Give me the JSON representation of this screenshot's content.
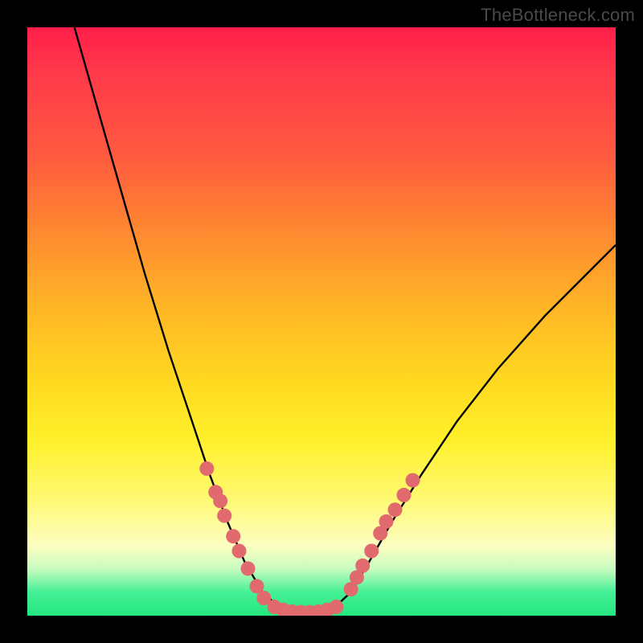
{
  "watermark": "TheBottleneck.com",
  "chart_data": {
    "type": "line",
    "title": "",
    "xlabel": "",
    "ylabel": "",
    "xlim": [
      0,
      100
    ],
    "ylim": [
      0,
      100
    ],
    "curve": {
      "name": "bottleneck-curve",
      "points": [
        {
          "x": 8,
          "y": 100
        },
        {
          "x": 12,
          "y": 86
        },
        {
          "x": 16,
          "y": 72
        },
        {
          "x": 20,
          "y": 58
        },
        {
          "x": 24,
          "y": 45
        },
        {
          "x": 28,
          "y": 33
        },
        {
          "x": 31,
          "y": 24
        },
        {
          "x": 34,
          "y": 16
        },
        {
          "x": 37,
          "y": 9
        },
        {
          "x": 40,
          "y": 4
        },
        {
          "x": 43,
          "y": 1.2
        },
        {
          "x": 46,
          "y": 0.4
        },
        {
          "x": 49,
          "y": 0.4
        },
        {
          "x": 52,
          "y": 1.2
        },
        {
          "x": 55,
          "y": 4
        },
        {
          "x": 58,
          "y": 9
        },
        {
          "x": 62,
          "y": 16
        },
        {
          "x": 67,
          "y": 24
        },
        {
          "x": 73,
          "y": 33
        },
        {
          "x": 80,
          "y": 42
        },
        {
          "x": 88,
          "y": 51
        },
        {
          "x": 96,
          "y": 59
        },
        {
          "x": 100,
          "y": 63
        }
      ]
    },
    "series": [
      {
        "name": "markers-left",
        "color": "#e06a6e",
        "points": [
          {
            "x": 30.5,
            "y": 25
          },
          {
            "x": 32,
            "y": 21
          },
          {
            "x": 32.8,
            "y": 19.5
          },
          {
            "x": 33.5,
            "y": 17
          },
          {
            "x": 35,
            "y": 13.5
          },
          {
            "x": 36,
            "y": 11
          },
          {
            "x": 37.5,
            "y": 8
          },
          {
            "x": 39,
            "y": 5
          },
          {
            "x": 40.2,
            "y": 3
          }
        ]
      },
      {
        "name": "markers-bottom",
        "color": "#e06a6e",
        "points": [
          {
            "x": 42,
            "y": 1.5
          },
          {
            "x": 43.5,
            "y": 1.0
          },
          {
            "x": 45,
            "y": 0.7
          },
          {
            "x": 46.5,
            "y": 0.6
          },
          {
            "x": 48,
            "y": 0.6
          },
          {
            "x": 49.5,
            "y": 0.7
          },
          {
            "x": 51,
            "y": 1.0
          },
          {
            "x": 52.5,
            "y": 1.5
          }
        ]
      },
      {
        "name": "markers-right",
        "color": "#e06a6e",
        "points": [
          {
            "x": 55,
            "y": 4.5
          },
          {
            "x": 56,
            "y": 6.5
          },
          {
            "x": 57,
            "y": 8.5
          },
          {
            "x": 58.5,
            "y": 11
          },
          {
            "x": 60,
            "y": 14
          },
          {
            "x": 61,
            "y": 16
          },
          {
            "x": 62.5,
            "y": 18
          },
          {
            "x": 64,
            "y": 20.5
          },
          {
            "x": 65.5,
            "y": 23
          }
        ]
      }
    ]
  }
}
